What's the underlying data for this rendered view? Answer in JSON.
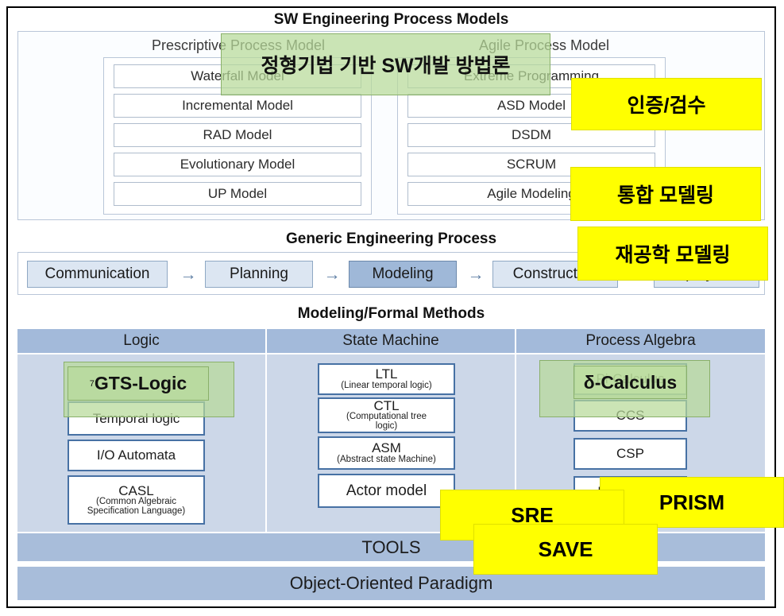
{
  "diagram": {
    "title": "SW Engineering Process Models",
    "sections": {
      "sw_engineering": "SW Engineering Process Models",
      "generic_engineering": "Generic Engineering Process",
      "modeling_formal": "Modeling/Formal Methods"
    }
  },
  "process_models": {
    "prescriptive_label": "Prescriptive Process Model",
    "agile_label": "Agile Process Model",
    "prescriptive_items": [
      "Waterfall Model",
      "Incremental Model",
      "RAD Model",
      "Evolutionary Model",
      "UP Model"
    ],
    "agile_items": [
      "Extreme Programming",
      "ASD Model",
      "DSDM",
      "SCRUM",
      "Agile Modeling"
    ]
  },
  "generic_process": {
    "steps": [
      {
        "label": "Communication",
        "active": false
      },
      {
        "label": "Planning",
        "active": false
      },
      {
        "label": "Modeling",
        "active": true
      },
      {
        "label": "Construction",
        "active": false
      },
      {
        "label": "Deployment",
        "active": false
      }
    ],
    "arrow_glyph": "→"
  },
  "formal_methods": {
    "columns": [
      "Logic",
      "State  Machine",
      "Process  Algebra"
    ],
    "logic": [
      {
        "main": "Temporal logic",
        "sub": ""
      },
      {
        "main": "I/O Automata",
        "sub": ""
      },
      {
        "main": "CASL",
        "sub": "(Common  Algebraic\nSpecification  Language)"
      }
    ],
    "state_machine": [
      {
        "main": "LTL",
        "sub": "(Linear temporal  logic)"
      },
      {
        "main": "CTL",
        "sub": "(Computational  tree\nlogic)"
      },
      {
        "main": "ASM",
        "sub": "(Abstract state  Machine)"
      },
      {
        "main": "Actor model",
        "sub": ""
      }
    ],
    "process_algebra": [
      {
        "main": "Pi-Calculus",
        "sub": ""
      },
      {
        "main": "CCS",
        "sub": ""
      },
      {
        "main": "CSP",
        "sub": ""
      },
      {
        "main": "B-Calculus",
        "sub": ""
      }
    ]
  },
  "bottom_bars": [
    "TOOLS",
    "Object-Oriented Paradigm"
  ],
  "green_callouts": [
    {
      "id": "methodology",
      "text": "정형기법 기반 SW개발 방법론"
    },
    {
      "id": "gts-logic",
      "text": "GTS-Logic",
      "superscript": "7"
    },
    {
      "id": "delta-calculus",
      "text": "δ-Calculus"
    }
  ],
  "yellow_callouts": [
    {
      "id": "certification",
      "text": "인증/검수"
    },
    {
      "id": "integrated-modeling",
      "text": "통합 모델링"
    },
    {
      "id": "reengineering-modeling",
      "text": "재공학 모델링"
    },
    {
      "id": "sre",
      "text": "SRE"
    },
    {
      "id": "save",
      "text": "SAVE"
    },
    {
      "id": "prism",
      "text": "PRISM"
    }
  ],
  "colors": {
    "green_callout": "#b7da98",
    "yellow_callout": "#ffff00",
    "header_blue": "#a3bada",
    "body_blue": "#ccd7e8",
    "box_border_blue": "#4771a4",
    "active_step": "#9fb8d8"
  }
}
